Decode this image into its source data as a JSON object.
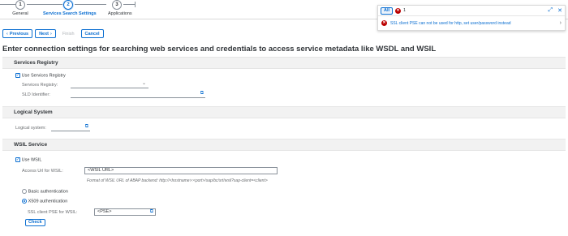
{
  "roadmap": {
    "steps": [
      {
        "num": "1",
        "label": "General"
      },
      {
        "num": "2",
        "label": "Services Search Settings"
      },
      {
        "num": "3",
        "label": "Applications"
      }
    ]
  },
  "toolbar": {
    "previous": "Previous",
    "next": "Next",
    "finish": "Finish",
    "cancel": "Cancel",
    "previous_icon": "chevron-left-icon",
    "next_icon": "chevron-right-icon"
  },
  "page_title": "Enter connection settings for searching web services and credentials  to access service metadata like WSDL and WSIL",
  "services_registry": {
    "heading": "Services Registry",
    "use_label": "Use Services Registry",
    "registry_label": "Services Registry:",
    "registry_value": "",
    "sld_label": "SLD Identifier:",
    "sld_value": ""
  },
  "logical_system": {
    "heading": "Logical System",
    "label": "Logical system:",
    "value": ""
  },
  "wsil": {
    "heading": "WSIL Service",
    "use_label": "Use WSIL",
    "url_label": "Access Url for WSIL:",
    "url_value": "<WSIL URL>",
    "hint": "Format of WSIL URL of ABAP backend: http://<hostname>:<port>/sap/bc/srt/wsil?sap-client=<client>",
    "basic_auth": "Basic authentication",
    "x509_auth": "X509 authentication",
    "pse_label": "SSL client PSE for WSIL:",
    "pse_value": "<PSE>",
    "check": "Check"
  },
  "messages": {
    "filter_all": "All",
    "error_count": "1",
    "items": [
      {
        "type": "error",
        "text": "SSL client PSE can not be used for http, set user/password instead"
      }
    ]
  },
  "colors": {
    "accent": "#0a6ed1",
    "error": "#bb0000"
  }
}
